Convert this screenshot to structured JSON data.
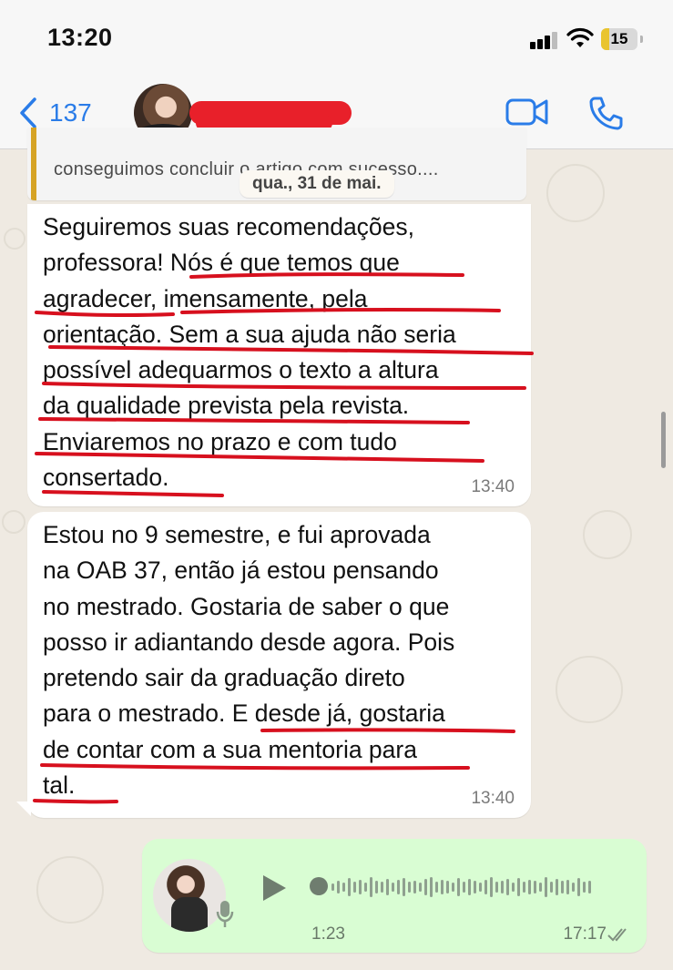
{
  "status_bar": {
    "time": "13:20",
    "battery_level": "15",
    "signal_icon": "cellular-signal-icon",
    "wifi_icon": "wifi-icon",
    "battery_color": "#e9c42e"
  },
  "header": {
    "back_count": "137",
    "back_icon": "chevron-left-icon",
    "video_icon": "video-call-icon",
    "call_icon": "phone-call-icon",
    "accent_color": "#2a7ce8",
    "redaction_color": "#e8202a"
  },
  "quoted": {
    "text": "conseguimos concluir o artigo com sucesso...."
  },
  "date_chip": "qua., 31 de mai.",
  "messages": [
    {
      "text": "Seguiremos suas recomendações,\nprofessora! Nós é que temos que\nagradecer, imensamente, pela\norientação. Sem a sua ajuda não seria\npossível adequarmos o texto a altura\nda qualidade prevista pela revista.\nEnviaremos no prazo e com tudo\nconsertado.",
      "time": "13:40"
    },
    {
      "text": "Estou no 9 semestre, e fui aprovada\nna OAB 37, então já estou pensando\nno mestrado. Gostaria de saber o que\nposso ir adiantando desde agora. Pois\npretendo sair da graduação direto\npara o mestrado. E desde já, gostaria\nde contar com a sua mentoria para\ntal.",
      "time": "13:40"
    }
  ],
  "voice_note": {
    "duration": "1:23",
    "time": "17:17",
    "play_icon": "play-icon",
    "mic_icon": "microphone-icon",
    "status_icon": "double-check-icon",
    "bubble_color": "#d9fdd3"
  },
  "annotation_color": "#d7101e"
}
